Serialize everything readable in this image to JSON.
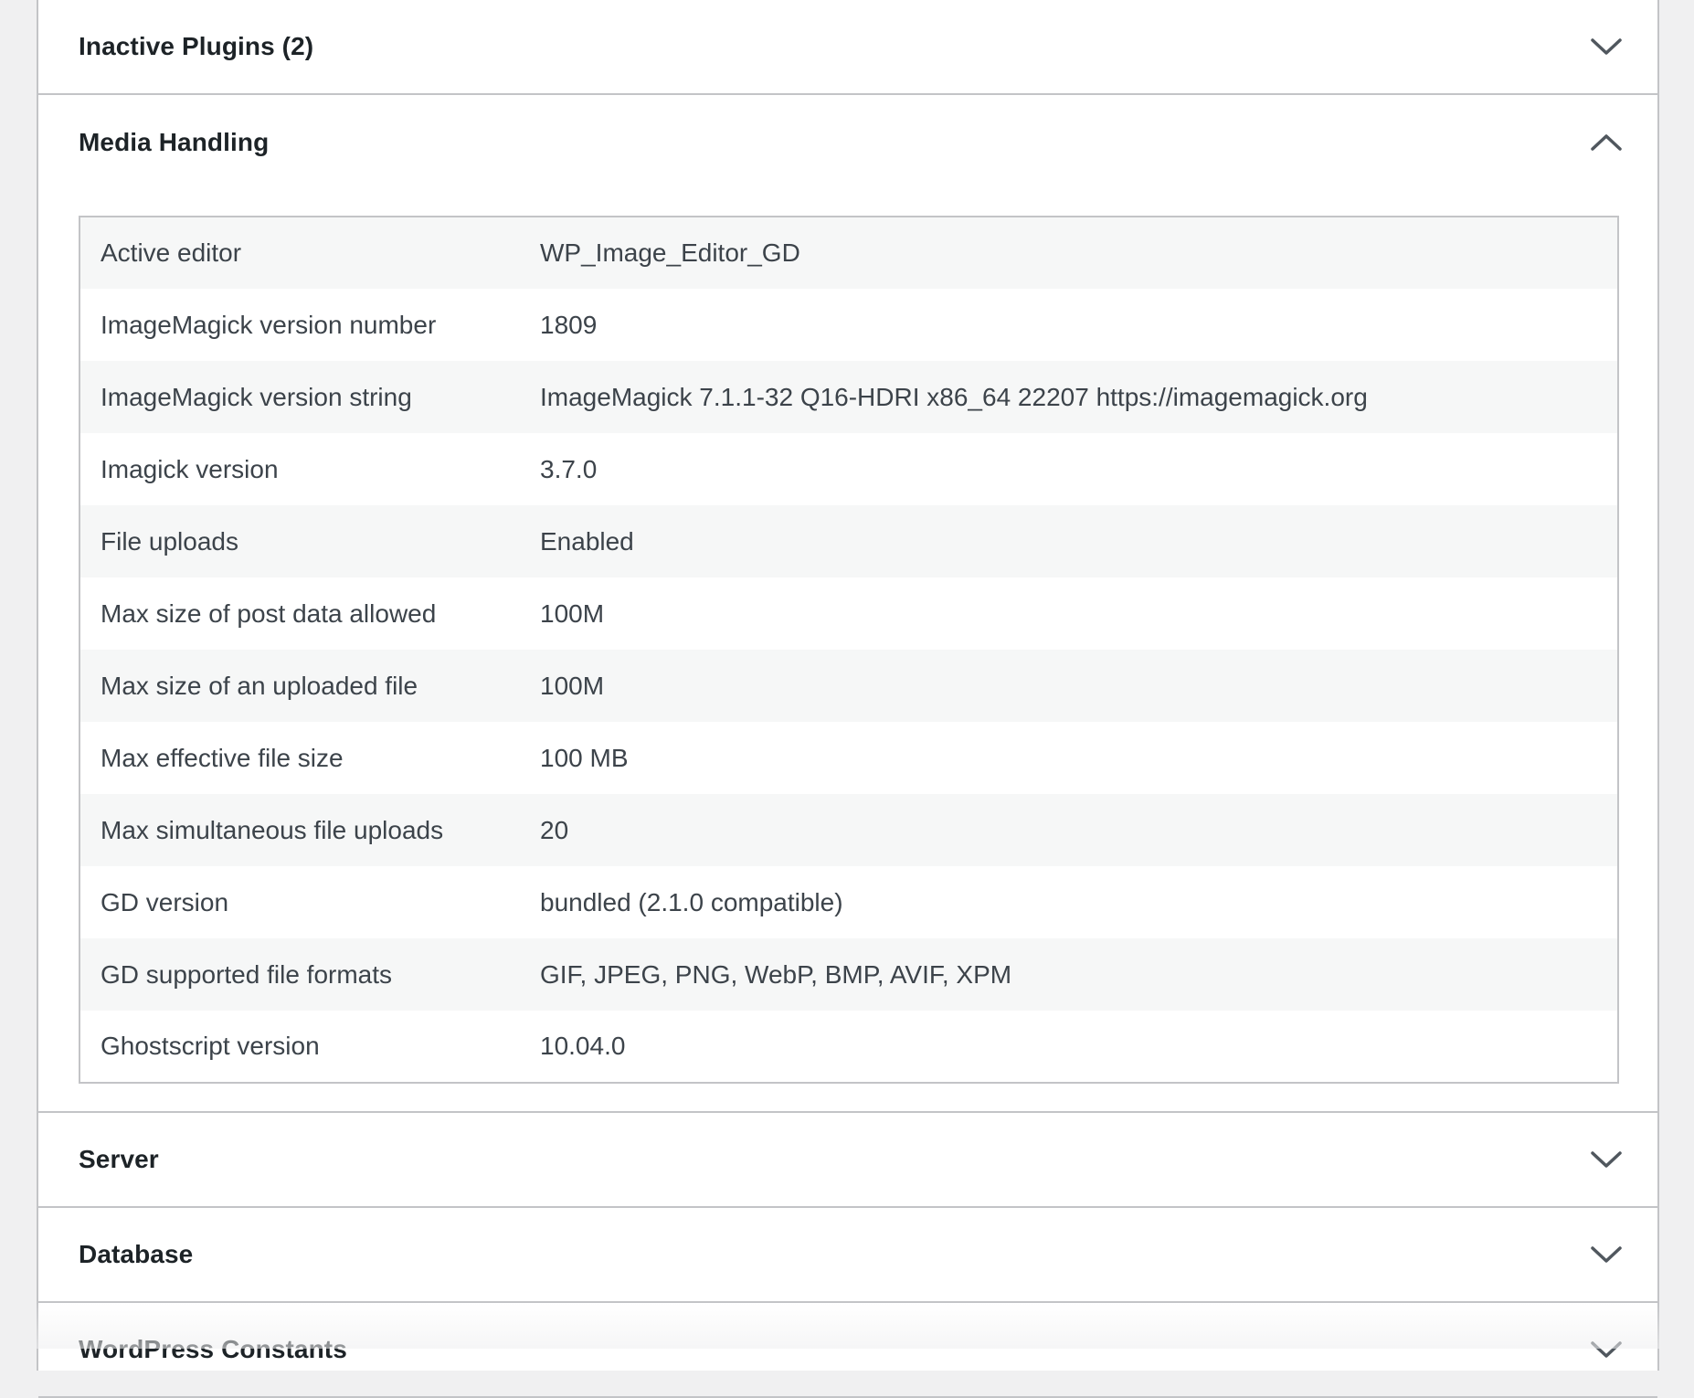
{
  "sections": {
    "inactive_plugins": {
      "title": "Inactive Plugins (2)",
      "state": "collapsed"
    },
    "media_handling": {
      "title": "Media Handling",
      "state": "expanded",
      "rows": [
        {
          "label": "Active editor",
          "value": "WP_Image_Editor_GD"
        },
        {
          "label": "ImageMagick version number",
          "value": "1809"
        },
        {
          "label": "ImageMagick version string",
          "value": "ImageMagick 7.1.1-32 Q16-HDRI x86_64 22207 https://imagemagick.org"
        },
        {
          "label": "Imagick version",
          "value": "3.7.0"
        },
        {
          "label": "File uploads",
          "value": "Enabled"
        },
        {
          "label": "Max size of post data allowed",
          "value": "100M"
        },
        {
          "label": "Max size of an uploaded file",
          "value": "100M"
        },
        {
          "label": "Max effective file size",
          "value": "100 MB"
        },
        {
          "label": "Max simultaneous file uploads",
          "value": "20"
        },
        {
          "label": "GD version",
          "value": "bundled (2.1.0 compatible)"
        },
        {
          "label": "GD supported file formats",
          "value": "GIF, JPEG, PNG, WebP, BMP, AVIF, XPM"
        },
        {
          "label": "Ghostscript version",
          "value": "10.04.0"
        }
      ]
    },
    "server": {
      "title": "Server",
      "state": "collapsed"
    },
    "database": {
      "title": "Database",
      "state": "collapsed"
    },
    "wordpress_constants": {
      "title": "WordPress Constants",
      "state": "collapsed"
    }
  },
  "icons": {
    "collapsed": "chevron-down-icon",
    "expanded": "chevron-up-icon"
  },
  "colors": {
    "border": "#c3c4c7",
    "stripe": "#f6f7f7",
    "heading_text": "#1d2327",
    "body_text": "#3c434a",
    "chevron": "#50575e"
  }
}
